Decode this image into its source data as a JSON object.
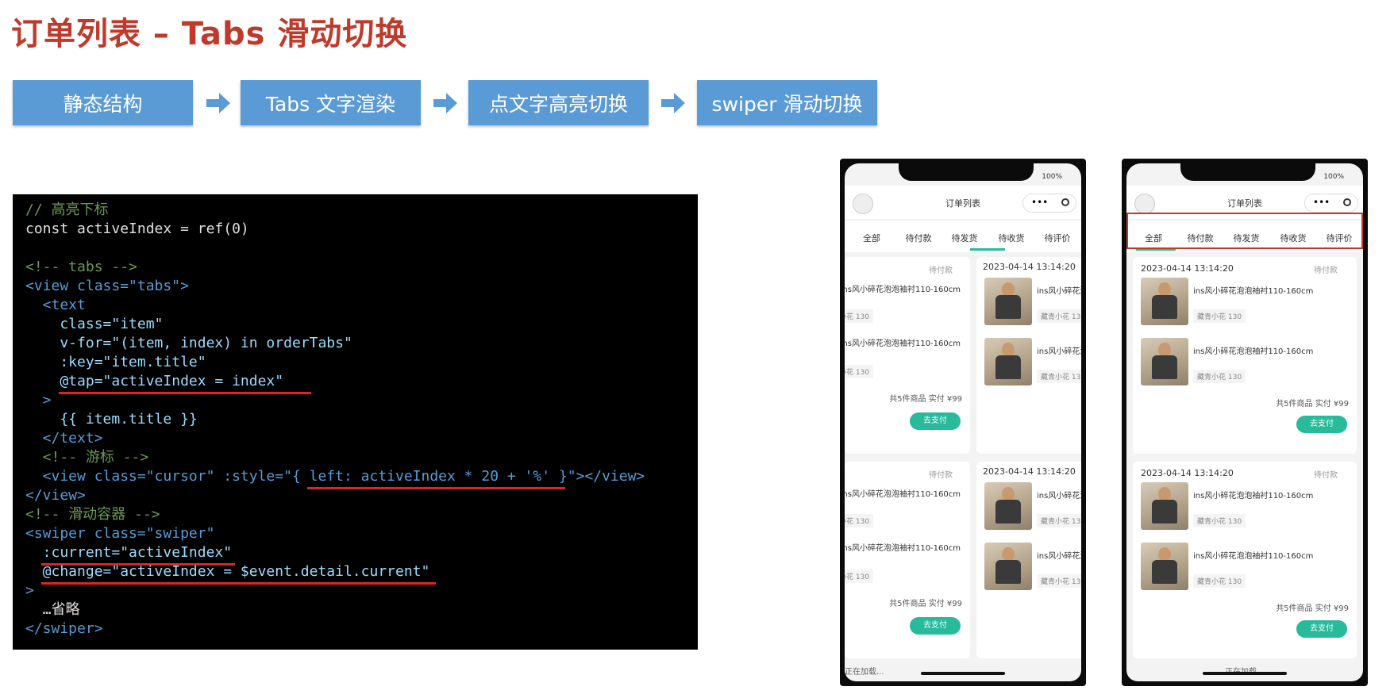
{
  "title": "订单列表 – Tabs 滑动切换",
  "flow": {
    "steps": [
      "静态结构",
      "Tabs 文字渲染",
      "点文字高亮切换",
      "swiper 滑动切换"
    ],
    "step_color": "#5b9bd5",
    "arrow_icon": "right-arrow-icon"
  },
  "code": {
    "lines": [
      "// 高亮下标",
      "const activeIndex = ref(0)",
      "",
      "<!-- tabs -->",
      "<view class=\"tabs\">",
      "  <text",
      "    class=\"item\"",
      "    v-for=\"(item, index) in orderTabs\"",
      "    :key=\"item.title\"",
      "    @tap=\"activeIndex = index\"",
      "  >",
      "    {{ item.title }}",
      "  </text>",
      "  <!-- 游标 -->",
      "  <view class=\"cursor\" :style=\"{ left: activeIndex * 20 + '%' }\"></view>",
      "</view>",
      "<!-- 滑动容器 -->",
      "<swiper class=\"swiper\"",
      "  :current=\"activeIndex\"",
      "  @change=\"activeIndex = $event.detail.current\"",
      ">",
      "  …省略",
      "</swiper>"
    ]
  },
  "phone": {
    "battery": "100%",
    "nav_title": "订单列表",
    "capsule_more": "•••",
    "capsule_close_icon": "target-icon",
    "tabs": [
      "全部",
      "待付款",
      "待发货",
      "待收货",
      "待评价"
    ],
    "order_time": "2023-04-14 13:14:20",
    "order_status": "待付款",
    "product_name": "ins风小碎花泡泡袖衬110-160cm",
    "product_spec": "藏青小花 130",
    "summary": "共5件商品  实付 ¥99",
    "pay_button": "去支付",
    "loading": "正在加载...",
    "accent_color": "#27ba9b"
  }
}
